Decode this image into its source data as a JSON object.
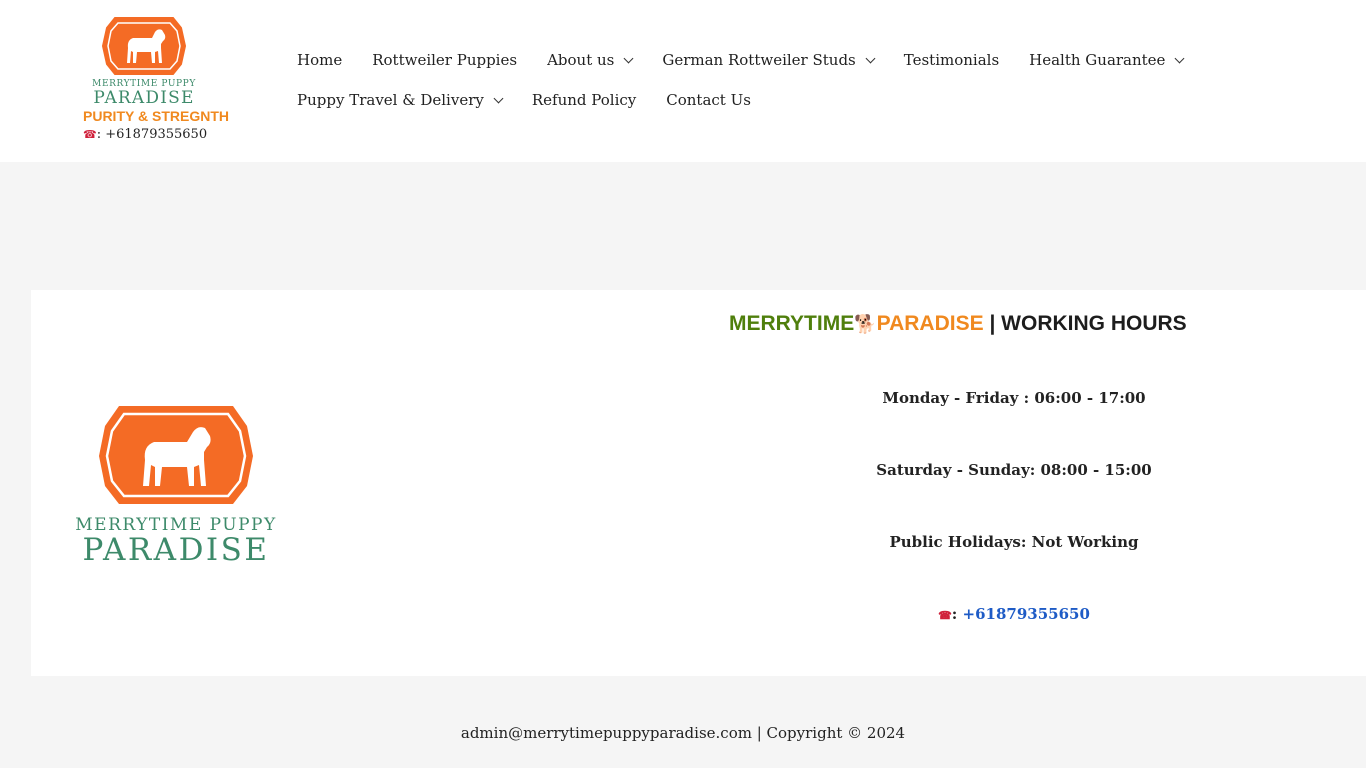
{
  "brand": {
    "logo_line1": "MERRYTIME PUPPY",
    "logo_line2": "PARADISE",
    "tagline": "PURITY & STREGNTH",
    "phone_icon": "☎",
    "phone_label": ": +61879355650"
  },
  "nav": {
    "row1": [
      {
        "label": "Home",
        "dropdown": false
      },
      {
        "label": "Rottweiler Puppies",
        "dropdown": false
      },
      {
        "label": "About us",
        "dropdown": true
      },
      {
        "label": "German Rottweiler Studs",
        "dropdown": true
      },
      {
        "label": "Testimonials",
        "dropdown": false
      },
      {
        "label": "Health Guarantee",
        "dropdown": true
      }
    ],
    "row2": [
      {
        "label": "Puppy Travel & Delivery",
        "dropdown": true
      },
      {
        "label": "Refund Policy",
        "dropdown": false
      },
      {
        "label": "Contact Us",
        "dropdown": false
      }
    ]
  },
  "hours": {
    "title_green": "MERRYTIME",
    "title_icon": "🐕",
    "title_orange": "PARADISE",
    "title_rest": " | WORKING HOURS",
    "weekdays": "Monday - Friday : 06:00 - 17:00",
    "weekend": "Saturday - Sunday: 08:00 - 15:00",
    "holidays": "Public Holidays: Not Working",
    "phone_icon": "☎",
    "phone_sep": ": ",
    "phone_number": "+61879355650"
  },
  "footer": {
    "text": "admin@merrytimepuppyparadise.com | Copyright © 2024"
  },
  "colors": {
    "orange": "#f0891f",
    "logo_orange": "#f46b25",
    "green": "#4f7f0c",
    "logo_green": "#3d8a6a",
    "link_blue": "#1e5bc6"
  }
}
